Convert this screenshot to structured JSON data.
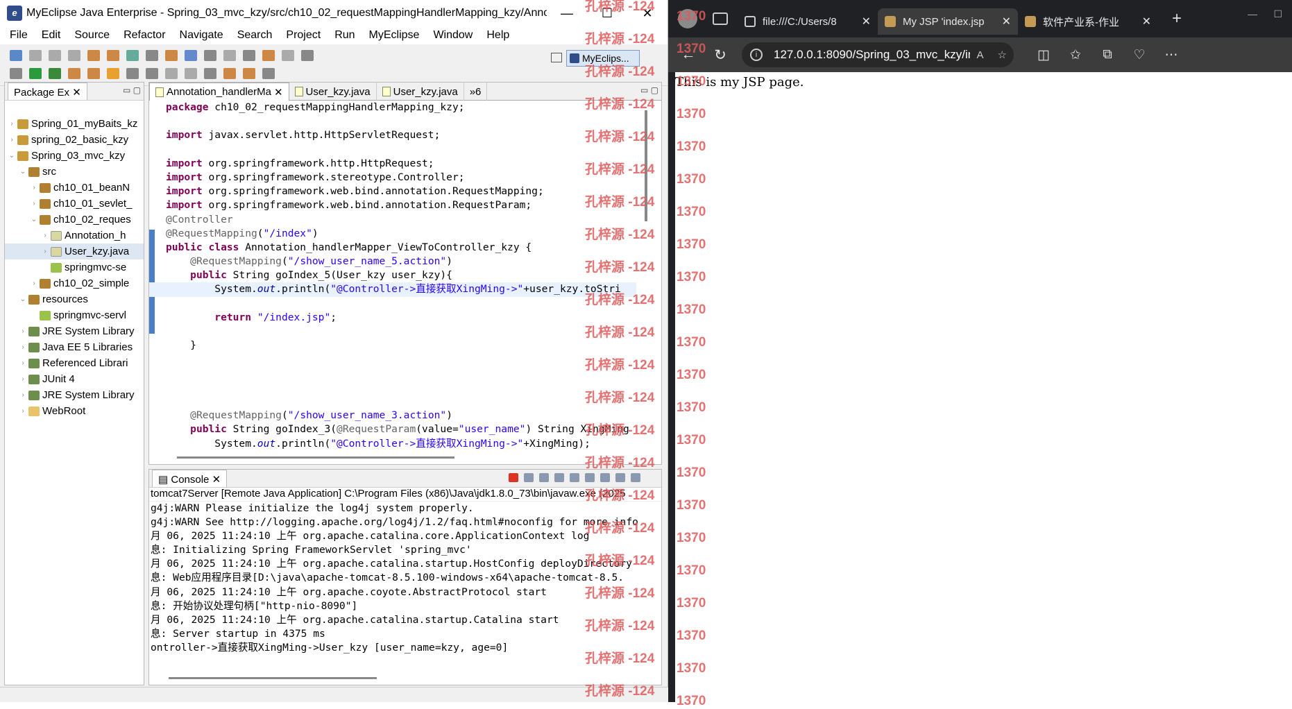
{
  "ide": {
    "title": "MyEclipse Java Enterprise - Spring_03_mvc_kzy/src/ch10_02_requestMappingHandlerMapping_kzy/Annotation_...",
    "menu": [
      "File",
      "Edit",
      "Source",
      "Refactor",
      "Navigate",
      "Search",
      "Project",
      "Run",
      "MyEclipse",
      "Window",
      "Help"
    ],
    "perspective": "MyEclips...",
    "package_explorer": {
      "title": "Package Ex",
      "items": [
        {
          "label": "Spring_01_myBaits_kz",
          "indent": 0,
          "tw": "›",
          "icon": "proj"
        },
        {
          "label": "spring_02_basic_kzy",
          "indent": 0,
          "tw": "›",
          "icon": "proj"
        },
        {
          "label": "Spring_03_mvc_kzy",
          "indent": 0,
          "tw": "⌄",
          "icon": "proj"
        },
        {
          "label": "src",
          "indent": 1,
          "tw": "⌄",
          "icon": "pkg"
        },
        {
          "label": "ch10_01_beanN",
          "indent": 2,
          "tw": "›",
          "icon": "pkg"
        },
        {
          "label": "ch10_01_sevlet_",
          "indent": 2,
          "tw": "›",
          "icon": "pkg"
        },
        {
          "label": "ch10_02_reques",
          "indent": 2,
          "tw": "⌄",
          "icon": "pkg"
        },
        {
          "label": "Annotation_h",
          "indent": 3,
          "tw": "›",
          "icon": "java"
        },
        {
          "label": "User_kzy.java",
          "indent": 3,
          "tw": "›",
          "icon": "java",
          "selected": true
        },
        {
          "label": "springmvc-se",
          "indent": 3,
          "tw": "",
          "icon": "xml"
        },
        {
          "label": "ch10_02_simple",
          "indent": 2,
          "tw": "›",
          "icon": "pkg"
        },
        {
          "label": "resources",
          "indent": 1,
          "tw": "⌄",
          "icon": "pkg"
        },
        {
          "label": "springmvc-servl",
          "indent": 2,
          "tw": "",
          "icon": "xml"
        },
        {
          "label": "JRE System Library",
          "indent": 1,
          "tw": "›",
          "icon": "lib"
        },
        {
          "label": "Java EE 5 Libraries",
          "indent": 1,
          "tw": "›",
          "icon": "lib"
        },
        {
          "label": "Referenced Librari",
          "indent": 1,
          "tw": "›",
          "icon": "lib"
        },
        {
          "label": "JUnit 4",
          "indent": 1,
          "tw": "›",
          "icon": "lib"
        },
        {
          "label": "JRE System Library",
          "indent": 1,
          "tw": "›",
          "icon": "lib"
        },
        {
          "label": "WebRoot",
          "indent": 1,
          "tw": "›",
          "icon": "fold"
        }
      ]
    },
    "editor_tabs": [
      {
        "label": "Annotation_handlerMa",
        "active": true,
        "close": "✕"
      },
      {
        "label": "User_kzy.java",
        "active": false,
        "close": ""
      },
      {
        "label": "User_kzy.java",
        "active": false,
        "close": ""
      },
      {
        "label": "»6",
        "active": false,
        "close": ""
      }
    ],
    "code_lines": [
      [
        [
          "kw",
          "package"
        ],
        [
          "t",
          " ch10_02_requestMappingHandlerMapping_kzy;"
        ]
      ],
      [],
      [
        [
          "kw",
          "import"
        ],
        [
          "t",
          " javax.servlet.http.HttpServletRequest;"
        ]
      ],
      [],
      [
        [
          "kw",
          "import"
        ],
        [
          "t",
          " org.springframework.http.HttpRequest;"
        ]
      ],
      [
        [
          "kw",
          "import"
        ],
        [
          "t",
          " org.springframework.stereotype.Controller;"
        ]
      ],
      [
        [
          "kw",
          "import"
        ],
        [
          "t",
          " org.springframework.web.bind.annotation.RequestMapping;"
        ]
      ],
      [
        [
          "kw",
          "import"
        ],
        [
          "t",
          " org.springframework.web.bind.annotation.RequestParam;"
        ]
      ],
      [
        [
          "ann",
          "@Controller"
        ]
      ],
      [
        [
          "ann",
          "@RequestMapping"
        ],
        [
          "t",
          "("
        ],
        [
          "str",
          "\"/index\""
        ],
        [
          "t",
          ")"
        ]
      ],
      [
        [
          "kw",
          "public class"
        ],
        [
          "t",
          " Annotation_handlerMapper_ViewToController_kzy {"
        ]
      ],
      [
        [
          "t",
          "    "
        ],
        [
          "ann",
          "@RequestMapping"
        ],
        [
          "t",
          "("
        ],
        [
          "str",
          "\"/show_user_name_5.action\""
        ],
        [
          "t",
          ")"
        ]
      ],
      [
        [
          "t",
          "    "
        ],
        [
          "kw",
          "public"
        ],
        [
          "t",
          " String goIndex_5(User_kzy user_kzy){"
        ]
      ],
      [
        [
          "t",
          "        System."
        ],
        [
          "fld",
          "out"
        ],
        [
          "t",
          ".println("
        ],
        [
          "str",
          "\"@Controller->直接获取XingMing->\""
        ],
        [
          "t",
          "+user_kzy.toStri"
        ]
      ],
      [],
      [
        [
          "t",
          "        "
        ],
        [
          "kw",
          "return"
        ],
        [
          "t",
          " "
        ],
        [
          "str",
          "\"/index.jsp\""
        ],
        [
          "t",
          ";"
        ]
      ],
      [],
      [
        [
          "t",
          "    }"
        ]
      ],
      [],
      [],
      [],
      [],
      [
        [
          "t",
          "    "
        ],
        [
          "ann",
          "@RequestMapping"
        ],
        [
          "t",
          "("
        ],
        [
          "str",
          "\"/show_user_name_3.action\""
        ],
        [
          "t",
          ")"
        ]
      ],
      [
        [
          "t",
          "    "
        ],
        [
          "kw",
          "public"
        ],
        [
          "t",
          " String goIndex_3("
        ],
        [
          "ann",
          "@RequestParam"
        ],
        [
          "t",
          "(value="
        ],
        [
          "str",
          "\"user_name\""
        ],
        [
          "t",
          ") String XingMing"
        ]
      ],
      [
        [
          "t",
          "        System."
        ],
        [
          "fld",
          "out"
        ],
        [
          "t",
          ".println("
        ],
        [
          "str",
          "\"@Controller->直接获取XingMing->\""
        ],
        [
          "t",
          "+XingMing);"
        ]
      ]
    ],
    "console": {
      "title": "Console",
      "header": "tomcat7Server [Remote Java Application] C:\\Program Files (x86)\\Java\\jdk1.8.0_73\\bin\\javaw.exe (2025",
      "lines": [
        "g4j:WARN Please initialize the log4j system properly.",
        "g4j:WARN See http://logging.apache.org/log4j/1.2/faq.html#noconfig for more info",
        "月 06, 2025 11:24:10 上午 org.apache.catalina.core.ApplicationContext log",
        "息: Initializing Spring FrameworkServlet 'spring_mvc'",
        "月 06, 2025 11:24:10 上午 org.apache.catalina.startup.HostConfig deployDirectory",
        "息: Web应用程序目录[D:\\java\\apache-tomcat-8.5.100-windows-x64\\apache-tomcat-8.5.",
        "月 06, 2025 11:24:10 上午 org.apache.coyote.AbstractProtocol start",
        "息: 开始协议处理句柄[\"http-nio-8090\"]",
        "月 06, 2025 11:24:10 上午 org.apache.catalina.startup.Catalina start",
        "息: Server startup in 4375 ms",
        "ontroller->直接获取XingMing->User_kzy [user_name=kzy, age=0]"
      ]
    }
  },
  "browser": {
    "tabs": [
      {
        "title": "file:///C:/Users/8",
        "active": false,
        "fav": "f1"
      },
      {
        "title": "My JSP 'index.jsp",
        "active": true,
        "fav": "f2"
      },
      {
        "title": "软件产业系-作业",
        "active": false,
        "fav": "f2"
      }
    ],
    "url": "127.0.0.1:8090/Spring_03_mvc_kzy/index...",
    "page_text": "This is my JSP page."
  },
  "watermark": {
    "name": "孔梓源 -124",
    "number": "1370"
  }
}
